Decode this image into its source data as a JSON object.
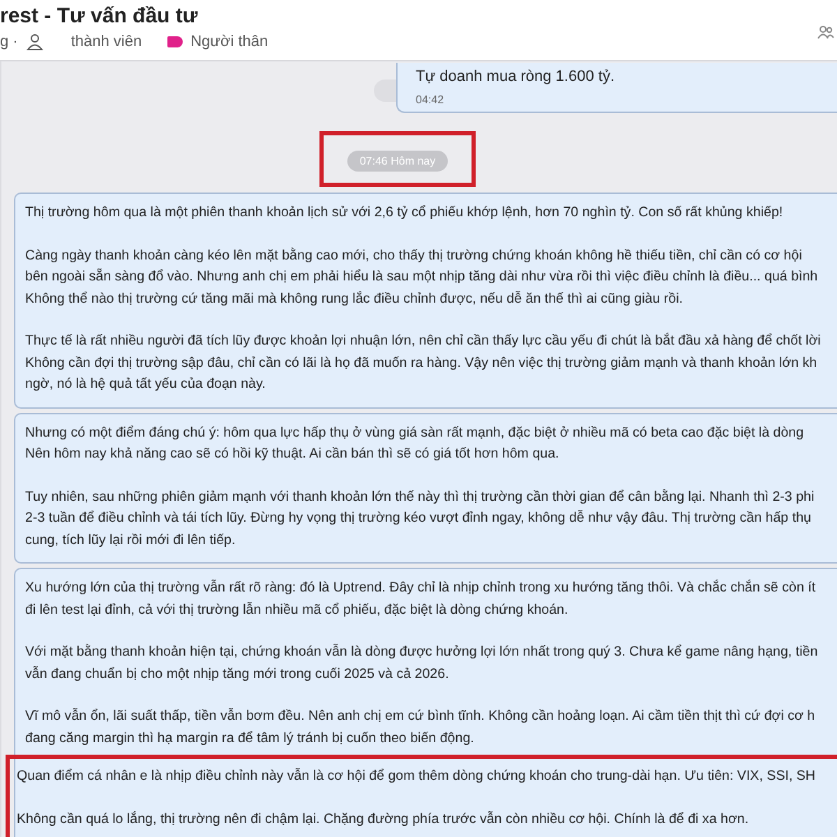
{
  "header": {
    "title": "rest - Tư vấn đầu tư",
    "subtitle_start": "g ·",
    "members": "thành viên",
    "tag": {
      "label": "Người thân",
      "color": "#e0218a"
    }
  },
  "previous_message": {
    "text": "Tự doanh mua ròng 1.600 tỷ.",
    "time": "04:42"
  },
  "time_divider": {
    "text": "07:46 Hôm nay",
    "highlighted": true
  },
  "messages": [
    {
      "blocks": [
        {
          "highlighted": false,
          "paragraphs": [
            [
              "Thị trường hôm qua là một phiên thanh khoản lịch sử với 2,6 tỷ cổ phiếu khớp lệnh, hơn 70 nghìn tỷ. Con số rất khủng khiếp!"
            ],
            [
              "Càng ngày thanh khoản càng kéo lên mặt bằng cao mới, cho thấy thị trường chứng khoán không hề thiếu tiền, chỉ cần có cơ hội",
              "bên ngoài sẵn sàng đổ vào. Nhưng anh chị em phải hiểu là sau một nhịp tăng dài như vừa rồi thì việc điều chỉnh là điều... quá bình",
              "Không thể nào thị trường cứ tăng mãi mà không rung lắc điều chỉnh được, nếu dễ ăn thế thì ai cũng giàu rồi."
            ],
            [
              "Thực tế là rất nhiều người đã tích lũy được khoản lợi nhuận lớn, nên chỉ cần thấy lực cầu yếu đi chút là bắt đầu xả hàng để chốt lời",
              "Không cần đợi thị trường sập đâu, chỉ cần có lãi là họ đã muốn ra hàng. Vậy nên việc thị trường giảm mạnh và thanh khoản lớn kh",
              "ngờ, nó là hệ quả tất yếu của đoạn này."
            ]
          ]
        }
      ]
    },
    {
      "blocks": [
        {
          "highlighted": false,
          "paragraphs": [
            [
              "Nhưng có một điểm đáng chú ý: hôm qua lực hấp thụ ở vùng giá sàn rất mạnh, đặc biệt ở nhiều mã có beta cao đặc biệt là dòng",
              "Nên hôm nay khả năng cao sẽ có hồi kỹ thuật. Ai cần bán thì sẽ có giá tốt hơn hôm qua."
            ],
            [
              "Tuy nhiên, sau những phiên giảm mạnh với thanh khoản lớn thế này thì thị trường cần thời gian để cân bằng lại. Nhanh thì 2-3 phi",
              "2-3 tuần để điều chỉnh và tái tích lũy. Đừng hy vọng thị trường kéo vượt đỉnh ngay, không dễ như vậy đâu. Thị trường cần hấp thụ",
              "cung, tích lũy lại rồi mới đi lên tiếp."
            ]
          ]
        }
      ]
    },
    {
      "blocks": [
        {
          "highlighted": false,
          "paragraphs": [
            [
              "Xu hướng lớn của thị trường vẫn rất rõ ràng: đó là Uptrend. Đây chỉ là nhịp chỉnh trong xu hướng tăng thôi. Và chắc chắn sẽ còn ít",
              "đi lên test lại đỉnh, cả với thị trường lẫn nhiều mã cổ phiếu, đặc biệt là dòng chứng khoán."
            ],
            [
              "Với mặt bằng thanh khoản hiện tại, chứng khoán vẫn là dòng được hưởng lợi lớn nhất trong quý 3. Chưa kể game nâng hạng, tiền",
              "vẫn đang chuẩn bị cho một nhịp tăng mới trong cuối 2025 và cả 2026."
            ],
            [
              "Vĩ mô vẫn ổn, lãi suất thấp, tiền vẫn bơm đều. Nên anh chị em cứ bình tĩnh. Không cần hoảng loạn. Ai cầm tiền thịt thì cứ đợi cơ h",
              "đang căng margin thì hạ margin ra để tâm lý tránh bị cuốn theo biến động."
            ]
          ]
        },
        {
          "highlighted": true,
          "paragraphs": [
            [
              "Quan điểm cá nhân e là nhịp điều chỉnh này vẫn là cơ hội để gom thêm dòng chứng khoán cho trung-dài hạn. Ưu tiên: VIX, SSI, SH"
            ],
            [
              "Không cần quá lo lắng, thị trường nên đi chậm lại. Chặng đường phía trước vẫn còn nhiều cơ hội. Chính là để đi xa hơn."
            ]
          ]
        }
      ]
    }
  ]
}
